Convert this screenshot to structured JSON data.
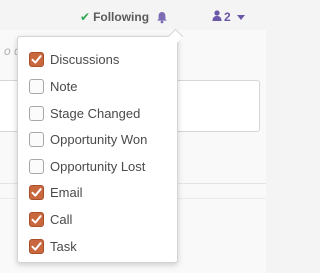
{
  "header": {
    "following_label": "Following",
    "followers_count": "2"
  },
  "background": {
    "hint_text": "o do"
  },
  "subtypes": [
    {
      "label": "Discussions",
      "checked": true
    },
    {
      "label": "Note",
      "checked": false
    },
    {
      "label": "Stage Changed",
      "checked": false
    },
    {
      "label": "Opportunity Won",
      "checked": false
    },
    {
      "label": "Opportunity Lost",
      "checked": false
    },
    {
      "label": "Email",
      "checked": true
    },
    {
      "label": "Call",
      "checked": true
    },
    {
      "label": "Task",
      "checked": true
    }
  ],
  "colors": {
    "checked_fill": "#c9683f",
    "following_check": "#2fa84f",
    "followers_accent": "#6b57a8"
  },
  "icons": {
    "following": "check-icon",
    "notifications": "bell-icon",
    "followers": "user-icon",
    "dropdown": "caret-down-icon",
    "option": "checkbox-icon"
  }
}
